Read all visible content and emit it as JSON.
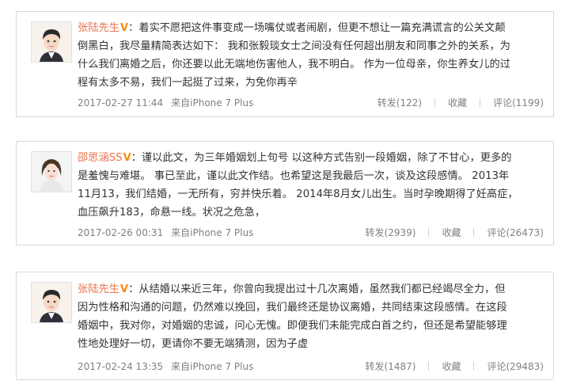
{
  "posts": [
    {
      "author": "张陆先生",
      "badge": "V",
      "colon": "：",
      "lines": [
        "着实不愿把这件事变成一场嘴仗或者闹剧，但更不想让一篇充满谎言的公关文颠",
        "倒黑白，我尽量精简表达如下： 我和张毅琰女士之间没有任何超出朋友和同事之外的关系，为",
        "什么我们离婚之后，你还要以此无端地伤害他人，我不明白。 作为一位母亲，你生养女儿的过",
        "程有太多不易，我们一起挺了过来，为免你再辛"
      ],
      "time": "2017-02-27 11:44",
      "source": "来自iPhone 7 Plus",
      "repost": "转发(122)",
      "favorite": "收藏",
      "comment": "评论(1199)"
    },
    {
      "author": "邵思涵SS",
      "badge": "V",
      "colon": "：",
      "lines": [
        "谨以此文，为三年婚姻划上句号 以这种方式告别一段婚姻，除了不甘心，更多的",
        "是羞愧与难堪。 事已至此，谨以此文作结。也希望这是我最后一次，谈及这段感情。 2013年",
        "11月13，我们结婚，一无所有，穷并快乐着。 2014年8月女儿出生。当时孕晚期得了妊高症，",
        "血压飙升183，命悬一线。状况之危急，"
      ],
      "time": "2017-02-26 00:31",
      "source": "来自iPhone 7 Plus",
      "repost": "转发(2939)",
      "favorite": "收藏",
      "comment": "评论(26473)"
    },
    {
      "author": "张陆先生",
      "badge": "V",
      "colon": "：",
      "lines": [
        "从结婚以来近三年，你曾向我提出过十几次离婚，虽然我们都已经竭尽全力，但",
        "因为性格和沟通的问题，仍然难以挽回，我们最终还是协议离婚，共同结束这段感情。在这段",
        "婚姻中，我对你，对婚姻的忠诚，问心无愧。即便我们未能完成白首之约，但还是希望能够理",
        "性地处理好一切，更请你不要无端猜测，因为子虚"
      ],
      "time": "2017-02-24 13:35",
      "source": "来自iPhone 7 Plus",
      "repost": "转发(1487)",
      "favorite": "收藏",
      "comment": "评论(29483)"
    }
  ]
}
